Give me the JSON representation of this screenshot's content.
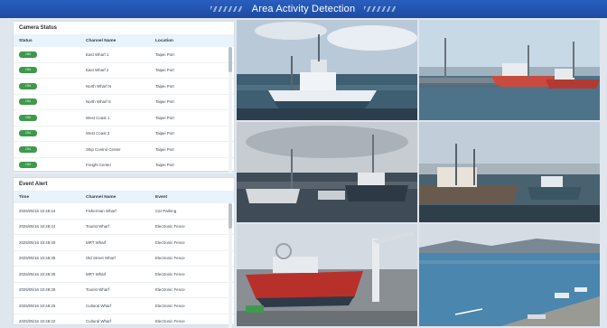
{
  "header": {
    "title": "Area Activity Detection"
  },
  "camera_status": {
    "title": "Camera Status",
    "columns": [
      "Status",
      "Channel Name",
      "Location"
    ],
    "rows": [
      {
        "status": "ON",
        "channel": "East Wharf 1",
        "location": "Taipei Port"
      },
      {
        "status": "ON",
        "channel": "East Wharf 2",
        "location": "Taipei Port"
      },
      {
        "status": "ON",
        "channel": "North Wharf N",
        "location": "Taipei Port"
      },
      {
        "status": "ON",
        "channel": "North Wharf S",
        "location": "Taipei Port"
      },
      {
        "status": "ON",
        "channel": "West Coast 1",
        "location": "Taipei Port"
      },
      {
        "status": "ON",
        "channel": "West Coast 2",
        "location": "Taipei Port"
      },
      {
        "status": "ON",
        "channel": "Ship Control Center",
        "location": "Taipei Port"
      },
      {
        "status": "ON",
        "channel": "Freight Center",
        "location": "Taipei Port"
      }
    ]
  },
  "event_alert": {
    "title": "Event Alert",
    "columns": [
      "Time",
      "Channel Name",
      "Event"
    ],
    "rows": [
      {
        "time": "2025/05/16 10:48:44",
        "channel": "Fisherman Wharf",
        "event": "Car Parking"
      },
      {
        "time": "2025/05/16 10:48:44",
        "channel": "Tourist Wharf",
        "event": "Electronic Fence"
      },
      {
        "time": "2025/05/16 10:48:40",
        "channel": "MRT Wharf",
        "event": "Electronic Fence"
      },
      {
        "time": "2025/05/16 10:48:35",
        "channel": "Old Street Wharf",
        "event": "Electronic Fence"
      },
      {
        "time": "2025/05/16 10:48:35",
        "channel": "MRT Wharf",
        "event": "Electronic Fence"
      },
      {
        "time": "2025/05/16 10:48:28",
        "channel": "Tourist Wharf",
        "event": "Electronic Fence"
      },
      {
        "time": "2025/05/16 10:48:26",
        "channel": "Cultural Wharf",
        "event": "Electronic Fence"
      },
      {
        "time": "2025/05/16 10:48:22",
        "channel": "Cultural Wharf",
        "event": "Electronic Fence"
      }
    ]
  },
  "colors": {
    "header": "#1d4aa3",
    "status_on": "#3d9a4b",
    "table_head": "#e8f3fb"
  }
}
